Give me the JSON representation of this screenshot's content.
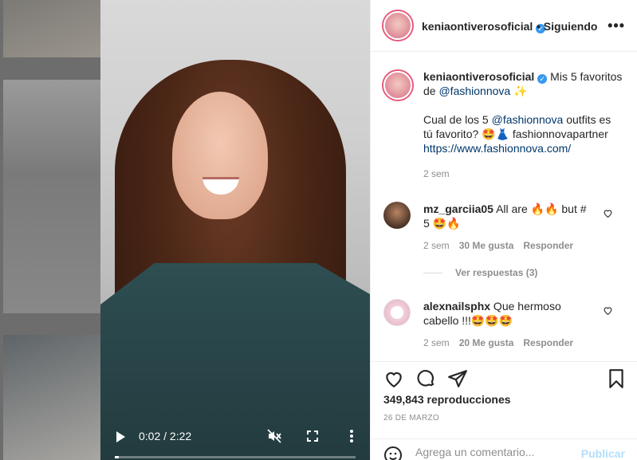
{
  "post": {
    "username": "keniaontiverosoficial",
    "following_label": "• Siguiendo",
    "more_label": "•••"
  },
  "caption": {
    "username": "keniaontiverosoficial",
    "text1": " Mis 5 favoritos de ",
    "mention1": "@fashionnova",
    "emoji1": "✨",
    "text2": "Cual de los 5 ",
    "mention2": "@fashionnova",
    "text3": " outfits es tú favorito? 🤩👗 fashionnovapartner",
    "url": "https://www.fashionnova.com/",
    "time": "2 sem"
  },
  "comments": [
    {
      "username": "mz_garciia05",
      "text": " All are 🔥🔥 but # 5 🤩🔥",
      "time": "2 sem",
      "likes": "30 Me gusta",
      "reply": "Responder",
      "view_replies": "Ver respuestas (3)"
    },
    {
      "username": "alexnailsphx",
      "text": " Que hermoso cabello !!!🤩🤩🤩",
      "time": "2 sem",
      "likes": "20 Me gusta",
      "reply": "Responder"
    }
  ],
  "stats": {
    "views": "349,843 reproducciones",
    "date": "26 DE MARZO"
  },
  "video": {
    "time": "0:02 / 2:22",
    "progress": 0.015
  },
  "add_comment": {
    "placeholder": "Agrega un comentario...",
    "publish": "Publicar"
  },
  "colors": {
    "link": "#00376b",
    "verified": "#3897f0",
    "publish_disabled": "#b2dffc"
  }
}
